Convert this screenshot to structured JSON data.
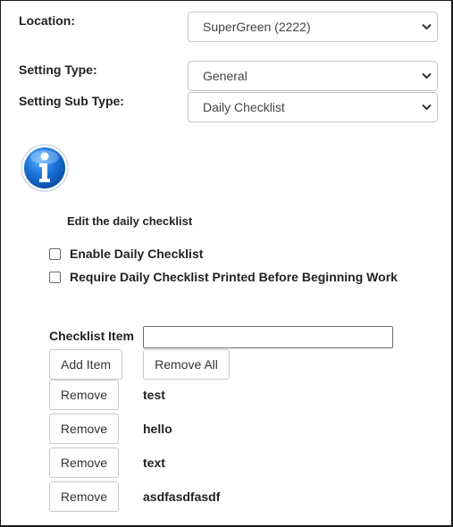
{
  "location": {
    "label": "Location:",
    "value": "SuperGreen (2222)"
  },
  "setting_type": {
    "label": "Setting Type:",
    "value": "General"
  },
  "setting_sub_type": {
    "label": "Setting Sub Type:",
    "value": "Daily Checklist"
  },
  "info": {
    "icon": "info-icon",
    "title": "Edit the daily checklist"
  },
  "options": {
    "enable_daily_checklist": {
      "label": "Enable Daily Checklist",
      "checked": false
    },
    "require_printed": {
      "label": "Require Daily Checklist Printed Before Beginning Work",
      "checked": false
    }
  },
  "checklist": {
    "label": "Checklist Item",
    "input_value": "",
    "add_label": "Add Item",
    "remove_all_label": "Remove All",
    "remove_label": "Remove",
    "items": [
      "test",
      "hello",
      "text",
      "asdfasdfasdf"
    ]
  },
  "colors": {
    "info_blue": "#1a73d9",
    "border": "#c9c9c9"
  }
}
